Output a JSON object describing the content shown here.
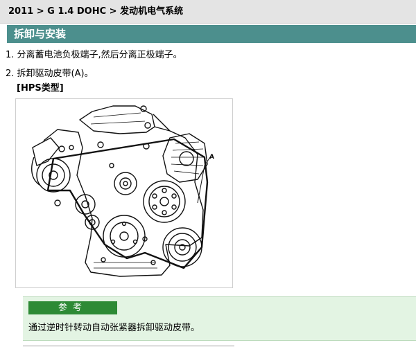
{
  "breadcrumb": {
    "text": "2011 > G 1.4 DOHC > 发动机电气系统"
  },
  "section": {
    "title": "拆卸与安装"
  },
  "steps": [
    {
      "num": "1.",
      "text": "分离蓄电池负极端子,然后分离正极端子。"
    },
    {
      "num": "2.",
      "text": "拆卸驱动皮带(A)。"
    }
  ],
  "subheading": "[HPS类型]",
  "figure": {
    "callout": "A"
  },
  "note": {
    "title": "参考",
    "text": "通过逆时针转动自动张紧器拆卸驱动皮带。",
    "accent": "#2d8a35",
    "background": "#e3f4e3"
  },
  "colors": {
    "section_bar": "#4c8f8d",
    "breadcrumb_bar": "#e4e4e4"
  }
}
